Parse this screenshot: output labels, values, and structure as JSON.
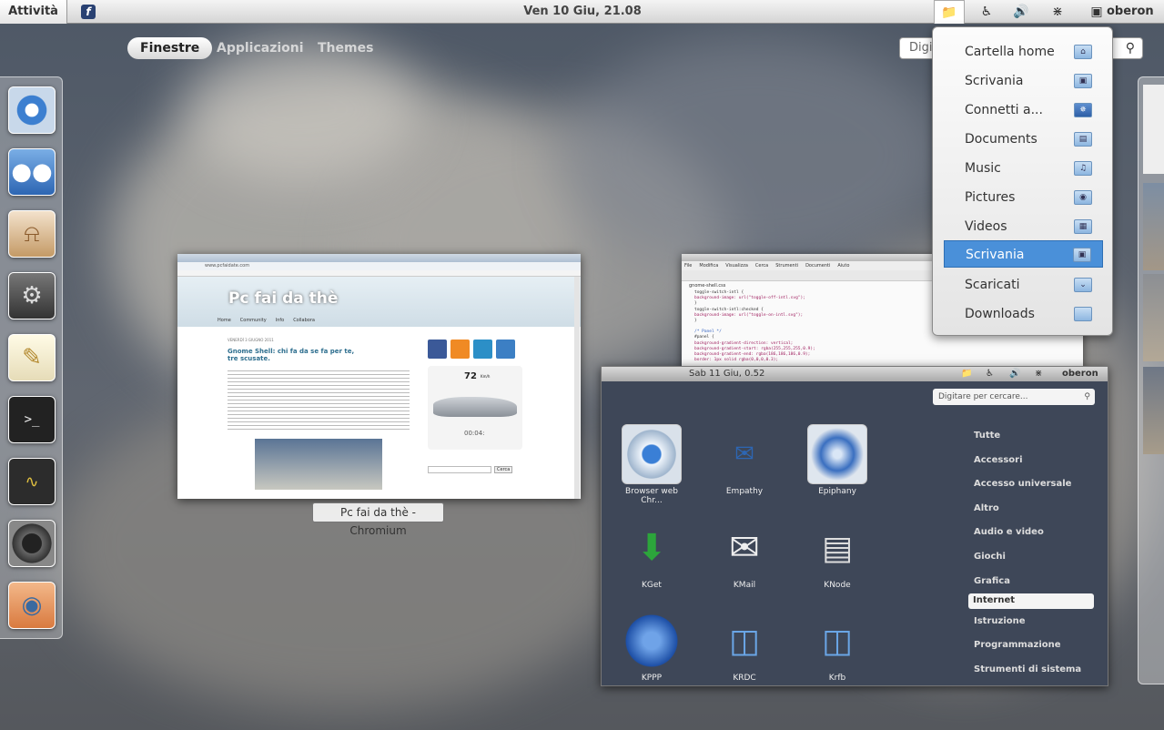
{
  "topbar": {
    "activities_label": "Attività",
    "clock": "Ven 10 Giu, 21.08",
    "user_name": "oberon",
    "icons": [
      "fedora-icon",
      "folder-icon",
      "accessibility-icon",
      "volume-icon",
      "wifi-icon",
      "chat-icon"
    ]
  },
  "overview": {
    "tabs": [
      {
        "label": "Finestre",
        "active": true
      },
      {
        "label": "Applicazioni",
        "active": false
      },
      {
        "label": "Themes",
        "active": false
      }
    ],
    "search_placeholder": "Digit"
  },
  "dash": {
    "items": [
      {
        "name": "chromium",
        "icon": "chromium-icon"
      },
      {
        "name": "empathy",
        "icon": "empathy-icon"
      },
      {
        "name": "nautilus",
        "icon": "nautilus-icon"
      },
      {
        "name": "settings",
        "icon": "settings-icon"
      },
      {
        "name": "text-editor",
        "icon": "text-editor-icon"
      },
      {
        "name": "terminal",
        "icon": "terminal-icon"
      },
      {
        "name": "system-monitor",
        "icon": "system-monitor-icon"
      },
      {
        "name": "cheese",
        "icon": "camera-icon"
      },
      {
        "name": "eye-of-gnome",
        "icon": "image-viewer-icon"
      }
    ]
  },
  "windows": {
    "chromium": {
      "caption": "Pc fai da thè - Chromium",
      "address": "www.pcfaidate.com",
      "site_title": "Pc fai da thè",
      "nav": [
        "Home",
        "Community",
        "Info",
        "Collabora"
      ],
      "date": "VENERDÌ 3 GIUGNO 2011",
      "post_title": "Gnome Shell: chi fa da se fa per te, tre scusate.",
      "widget_value": "72",
      "widget_unit": "Km/h",
      "widget_time": "00:04:",
      "search_button": "Cerca"
    },
    "gedit": {
      "menu": [
        "File",
        "Modifica",
        "Visualizza",
        "Cerca",
        "Strumenti",
        "Documenti",
        "Aiuto"
      ],
      "tab": "gnome-shell.css",
      "lines": [
        "toggle-switch-intl {",
        "  background-image: url(\"toggle-off-intl.svg\");",
        "}",
        "toggle-switch-intl:checked {",
        "  background-image: url(\"toggle-on-intl.svg\");",
        "}",
        "",
        "/* Panel */",
        "#panel {",
        "  background-gradient-direction: vertical;",
        "  background-gradient-start: rgba(255,255,255,0.9);",
        "  background-gradient-end: rgba(186,186,186,0.9);",
        "  border: 1px solid rgba(0,0,0,0.3);"
      ]
    },
    "screenshot": {
      "clock": "Sab 11 Giu,  0.52",
      "user_name": "oberon",
      "search_placeholder": "Digitare per cercare...",
      "apps": [
        {
          "label": "Browser web Chr...",
          "icon": "chromium-icon"
        },
        {
          "label": "Empathy",
          "icon": "empathy-icon"
        },
        {
          "label": "Epiphany",
          "icon": "epiphany-icon"
        },
        {
          "label": "KGet",
          "icon": "kget-icon"
        },
        {
          "label": "KMail",
          "icon": "kmail-icon"
        },
        {
          "label": "KNode",
          "icon": "knode-icon"
        },
        {
          "label": "KPPP",
          "icon": "kppp-icon"
        },
        {
          "label": "KRDC",
          "icon": "krdc-icon"
        },
        {
          "label": "Krfb",
          "icon": "krfb-icon"
        }
      ],
      "categories": [
        {
          "label": "Tutte",
          "selected": false
        },
        {
          "label": "Accessori",
          "selected": false
        },
        {
          "label": "Accesso universale",
          "selected": false
        },
        {
          "label": "Altro",
          "selected": false
        },
        {
          "label": "Audio e video",
          "selected": false
        },
        {
          "label": "Giochi",
          "selected": false
        },
        {
          "label": "Grafica",
          "selected": false
        },
        {
          "label": "Internet",
          "selected": true
        },
        {
          "label": "Istruzione",
          "selected": false
        },
        {
          "label": "Programmazione",
          "selected": false
        },
        {
          "label": "Strumenti di sistema",
          "selected": false
        }
      ]
    }
  },
  "places_menu": {
    "items": [
      {
        "label": "Cartella home",
        "icon": "home-folder-icon",
        "selected": false
      },
      {
        "label": "Scrivania",
        "icon": "desktop-folder-icon",
        "selected": false
      },
      {
        "label": "Connetti a...",
        "icon": "network-icon",
        "selected": false
      },
      {
        "label": "Documents",
        "icon": "documents-folder-icon",
        "selected": false
      },
      {
        "label": "Music",
        "icon": "music-folder-icon",
        "selected": false
      },
      {
        "label": "Pictures",
        "icon": "pictures-folder-icon",
        "selected": false
      },
      {
        "label": "Videos",
        "icon": "videos-folder-icon",
        "selected": false
      },
      {
        "label": "Scrivania",
        "icon": "desktop-folder-icon",
        "selected": true
      },
      {
        "label": "Scaricati",
        "icon": "downloads-folder-icon",
        "selected": false
      },
      {
        "label": "Downloads",
        "icon": "folder-icon",
        "selected": false
      }
    ]
  }
}
